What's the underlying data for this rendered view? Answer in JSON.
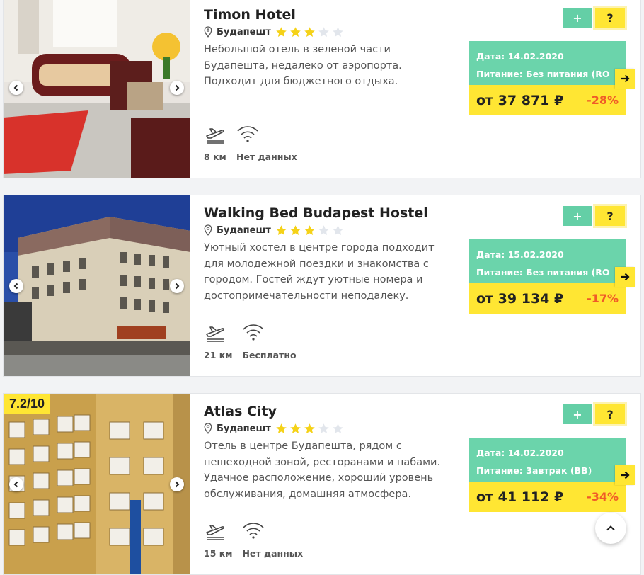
{
  "hotels": [
    {
      "name": "Timon Hotel",
      "city": "Будапешт",
      "stars": 3,
      "description": "Небольшой отель в зеленой части Будапешта, недалеко от аэропорта. Подходит для бюджетного отдыха.",
      "airport_distance": "8 км",
      "wifi": "Нет данных",
      "date_line": "Дата: 14.02.2020",
      "meal_line": "Питание: Без питания (RO",
      "price": "от 37 871 ₽",
      "discount": "-28%",
      "rating": ""
    },
    {
      "name": "Walking Bed Budapest Hostel",
      "city": "Будапешт",
      "stars": 3,
      "description": "Уютный хостел в центре города подходит для молодежной поездки и знакомства с городом. Гостей ждут уютные номера и достопримечательности неподалеку.",
      "airport_distance": "21 км",
      "wifi": "Бесплатно",
      "date_line": "Дата: 15.02.2020",
      "meal_line": "Питание: Без питания (RO",
      "price": "от 39 134 ₽",
      "discount": "-17%",
      "rating": ""
    },
    {
      "name": "Atlas City",
      "city": "Будапешт",
      "stars": 3,
      "description": "Отель в центре Будапешта, рядом с пешеходной зоной, ресторанами и пабами. Удачное расположение, хороший уровень обслуживания, домашняя атмосфера.",
      "airport_distance": "15 км",
      "wifi": "Нет данных",
      "date_line": "Дата: 14.02.2020",
      "meal_line": "Питание: Завтрак (BB)",
      "price": "от 41 112 ₽",
      "discount": "-34%",
      "rating": "7.2/10"
    }
  ],
  "buttons": {
    "add": "+",
    "help": "?"
  },
  "colors": {
    "green": "#6bd4ab",
    "yellow": "#ffe633",
    "discount": "#f05a28",
    "star_on": "#f5d218",
    "star_off": "#e2e6ec"
  },
  "icons": [
    "pin-icon",
    "star-icon",
    "airplane-icon",
    "wifi-icon",
    "arrow-right-icon",
    "chevron-left-icon",
    "chevron-right-icon",
    "chevron-up-icon"
  ]
}
